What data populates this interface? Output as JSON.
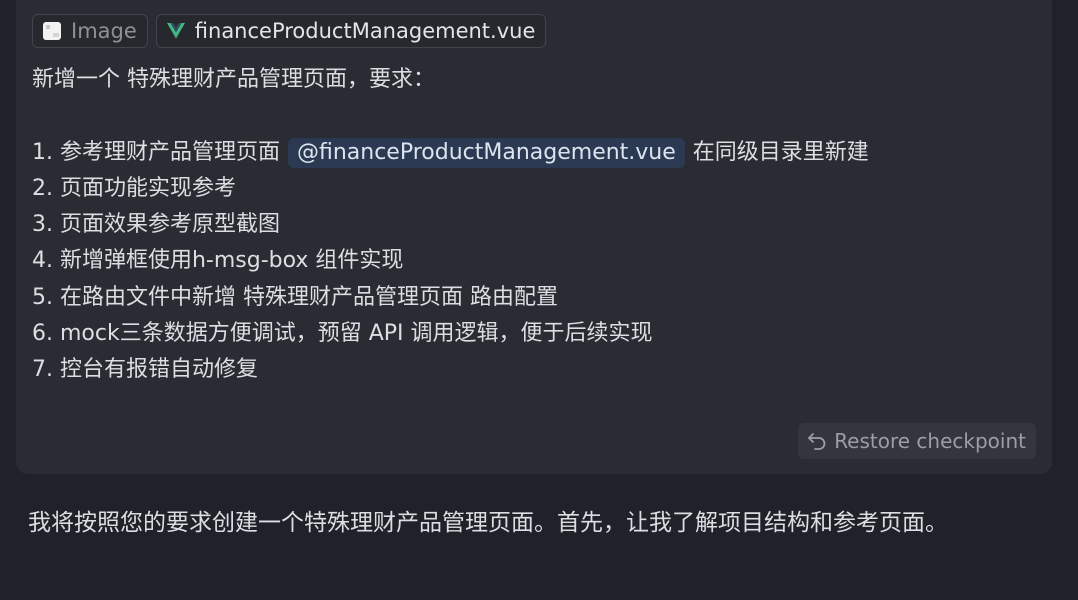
{
  "user_message": {
    "attachments": [
      {
        "label": "Image",
        "icon": "image-icon"
      },
      {
        "label": "financeProductManagement.vue",
        "icon": "vue-icon",
        "icon_color": "#41b883"
      }
    ],
    "intro": "新增一个 特殊理财产品管理页面，要求：",
    "line1_prefix": "1. 参考理财产品管理页面",
    "line1_mention": "@financeProductManagement.vue",
    "line1_suffix": "在同级目录里新建",
    "line2": "2. 页面功能实现参考",
    "line3": "3. 页面效果参考原型截图",
    "line4": "4. 新增弹框使用h-msg-box 组件实现",
    "line5": "5. 在路由文件中新增 特殊理财产品管理页面 路由配置",
    "line6": "6. mock三条数据方便调试，预留 API 调用逻辑，便于后续实现",
    "line7": "7. 控台有报错自动修复",
    "restore_label": "Restore checkpoint"
  },
  "assistant_message": {
    "text": "我将按照您的要求创建一个特殊理财产品管理页面。首先，让我了解项目结构和参考页面。"
  },
  "colors": {
    "background": "#20222a",
    "card": "#2a2c33",
    "mention_bg": "#2b3a52",
    "vue_green": "#41b883"
  }
}
